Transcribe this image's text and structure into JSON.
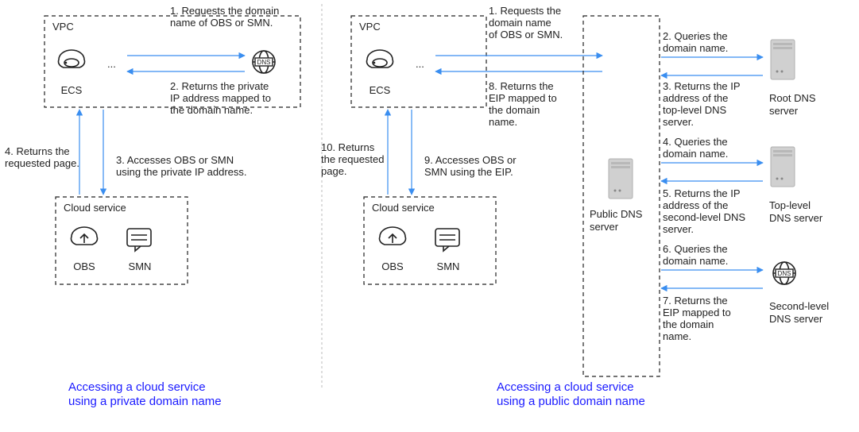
{
  "left": {
    "vpc_label": "VPC",
    "ecs_label": "ECS",
    "ellipsis": "...",
    "cloud_service_label": "Cloud service",
    "obs_label": "OBS",
    "smn_label": "SMN",
    "step1": "1. Requests the domain name of OBS or SMN.",
    "step2": "2. Returns the private IP address mapped to the domain name.",
    "step3": "3. Accesses OBS or SMN using the private IP address.",
    "step4": "4. Returns the requested page.",
    "title_l1": "Accessing a cloud service",
    "title_l2": "using a private domain name"
  },
  "right": {
    "vpc_label": "VPC",
    "ecs_label": "ECS",
    "ellipsis": "...",
    "cloud_service_label": "Cloud service",
    "obs_label": "OBS",
    "smn_label": "SMN",
    "public_dns_label_l1": "Public DNS",
    "public_dns_label_l2": "server",
    "root_dns_l1": "Root DNS",
    "root_dns_l2": "server",
    "top_dns_l1": "Top-level",
    "top_dns_l2": "DNS server",
    "second_dns_l1": "Second-level",
    "second_dns_l2": "DNS server",
    "step1": "1. Requests the domain name of OBS or SMN.",
    "step2": "2. Queries the domain name.",
    "step3": "3. Returns the IP address of the top-level DNS server.",
    "step4": "4. Queries the domain name.",
    "step5": "5. Returns the IP address of the second-level DNS server.",
    "step6": "6. Queries the domain name.",
    "step7": "7. Returns the EIP mapped to the domain name.",
    "step8": "8. Returns the EIP mapped to the domain name.",
    "step9": "9. Accesses OBS or SMN using the EIP.",
    "step10": "10. Returns the requested page.",
    "title_l1": "Accessing a cloud service",
    "title_l2": "using a public domain name"
  }
}
